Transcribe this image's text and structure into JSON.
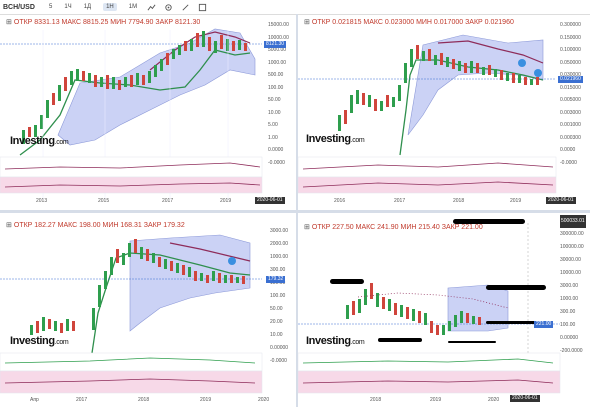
{
  "toolbar": {
    "symbol": "BCH/USD",
    "timeframes": [
      "5",
      "1Ч",
      "1Д",
      "1Н",
      "1М"
    ],
    "active_index": 3,
    "icons": [
      "line-chart-icon",
      "settings-icon",
      "draw-icon",
      "fullscreen-icon"
    ]
  },
  "panels": {
    "p1": {
      "ohlc": "ОТКР 8331.13  МАКС 8815.25  МИН 7794.90  ЗАКР 8121.30",
      "price_labels": [
        "15000.00",
        "10000.00",
        "5000.00",
        "1000.00",
        "500.00",
        "100.00",
        "50.00",
        "10.00",
        "5.00",
        "1.00",
        "0.0000",
        "-0.0000"
      ],
      "current_price": "8121.30",
      "date_label": "2020-06-01",
      "years": [
        "2013",
        "2015",
        "2017",
        "2019"
      ],
      "logo": "Investing",
      "logo_suffix": ".com"
    },
    "p2": {
      "ohlc": "ОТКР 0.021815  МАКС 0.023000  МИН 0.017000  ЗАКР 0.021960",
      "price_labels": [
        "0.300000",
        "0.150000",
        "0.100000",
        "0.050000",
        "0.030000",
        "0.015000",
        "0.005000",
        "0.003000",
        "0.001000",
        "0.000300",
        "0.0000",
        "-0.0000"
      ],
      "current_price": "0.021960",
      "date_label": "2020-06-01",
      "years": [
        "2016",
        "2017",
        "2018",
        "2019"
      ],
      "logo": "Investing",
      "logo_suffix": ".com"
    },
    "p3": {
      "ohlc": "ОТКР 182.27  МАКС 198.00  МИН 168.31  ЗАКР 179.32",
      "price_labels": [
        "3000.00",
        "2000.00",
        "1000.00",
        "300.00",
        "150.00",
        "100.00",
        "50.00",
        "20.00",
        "10.00",
        "0.00000",
        "-0.0000"
      ],
      "current_price": "179.32",
      "date_label": "",
      "years": [
        "Апр",
        "2017",
        "2018",
        "2019",
        "2020"
      ],
      "logo": "Investing",
      "logo_suffix": ".com"
    },
    "p4": {
      "ohlc": "ОТКР 227.50  МАКС 241.90  МИН 215.40  ЗАКР 221.00",
      "price_labels": [
        "500033.01",
        "300000.00",
        "100000.00",
        "30000.00",
        "10000.00",
        "3000.00",
        "1000.00",
        "300.00",
        "100.00",
        "0.00000",
        "-200.0000"
      ],
      "current_price": "221.00",
      "date_label": "2020-06-01",
      "years": [
        "2018",
        "2019",
        "2020"
      ],
      "logo": "Investing",
      "logo_suffix": ".com"
    }
  },
  "colors": {
    "cloud": "#b9c3f2",
    "cloud_border": "#8c99d8",
    "up": "#2e9e4d",
    "down": "#d0453c",
    "purple_line": "#8e2c5a",
    "green_line": "#2f8f4d",
    "price_line": "#3a6fd1"
  }
}
